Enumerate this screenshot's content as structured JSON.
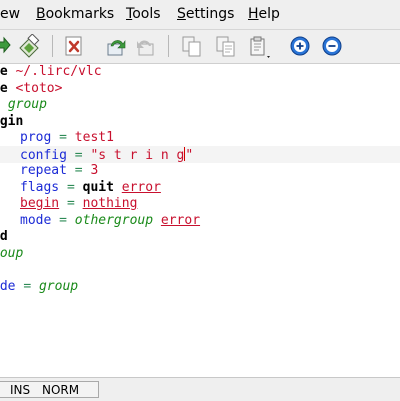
{
  "menubar": {
    "items": [
      {
        "label": "ew",
        "mnemonic": ""
      },
      {
        "label": "Bookmarks",
        "mnemonic": "B",
        "rest": "ookmarks"
      },
      {
        "label": "Tools",
        "mnemonic": "T",
        "rest": "ools"
      },
      {
        "label": "Settings",
        "mnemonic": "S",
        "rest": "ettings"
      },
      {
        "label": "Help",
        "mnemonic": "H",
        "rest": "elp"
      }
    ]
  },
  "toolbar": {
    "icons": [
      "redo-icon",
      "save-icon",
      "close-document-icon",
      "undo-icon",
      "redo-disabled-icon",
      "copy-icon",
      "cut-icon",
      "paste-icon",
      "zoom-in-icon",
      "zoom-out-icon"
    ]
  },
  "editor": {
    "lines": {
      "l1": {
        "kw": "de",
        "val": "~/.lirc/vlc"
      },
      "l2": {
        "kw": "de",
        "val": "<toto>"
      },
      "l3": {
        "sym": "group"
      },
      "l4": {
        "kw": "egin"
      },
      "l5": {
        "key": "prog",
        "op": "=",
        "val": "test1"
      },
      "l6": {
        "key": "config",
        "op": "=",
        "val_before": "\"s t r i n g",
        "val_after": "\""
      },
      "l7": {
        "key": "repeat",
        "op": "=",
        "val": "3"
      },
      "l8": {
        "key": "flags",
        "op": "=",
        "bold": "quit",
        "err": "error"
      },
      "l9": {
        "err1": "begin",
        "op": "=",
        "err2": "nothing"
      },
      "l10": {
        "key": "mode",
        "op": "=",
        "sym": "othergroup",
        "err": "error"
      },
      "l11": {
        "kw": "nd"
      },
      "l12": {
        "sym": "roup"
      },
      "l13": {
        "key": "ode",
        "op": "=",
        "sym": "group"
      }
    }
  },
  "statusbar": {
    "ins": "INS",
    "norm": "NORM"
  },
  "colors": {
    "keyword": "#000000",
    "string": "#c8102e",
    "operator": "#2e8b57",
    "symbol": "#1a8a1a",
    "key": "#1c2bd6",
    "error": "#c8102e"
  }
}
